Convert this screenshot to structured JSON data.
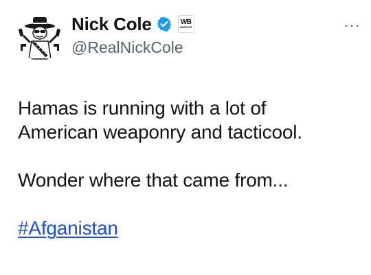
{
  "tweet": {
    "author": {
      "display_name": "Nick Cole",
      "handle": "@RealNickCole",
      "verified": true,
      "verified_color": "#1d9bf0",
      "affiliate_badge_text": "WB",
      "affiliate_badge_subtext": "WARGATE"
    },
    "more_label": "···",
    "text_lines": [
      "Hamas is running with a lot of",
      "American weaponry and tacticool.",
      "Wonder where that came from..."
    ],
    "hashtag": "#Afganistan",
    "colors": {
      "text": "#0f1419",
      "secondary": "#536471",
      "link": "#1d4ed8"
    },
    "icons": {
      "avatar": "avatar-cartoon-cowboy-icon",
      "verified": "verified-badge-icon",
      "more": "more-options-icon"
    }
  }
}
